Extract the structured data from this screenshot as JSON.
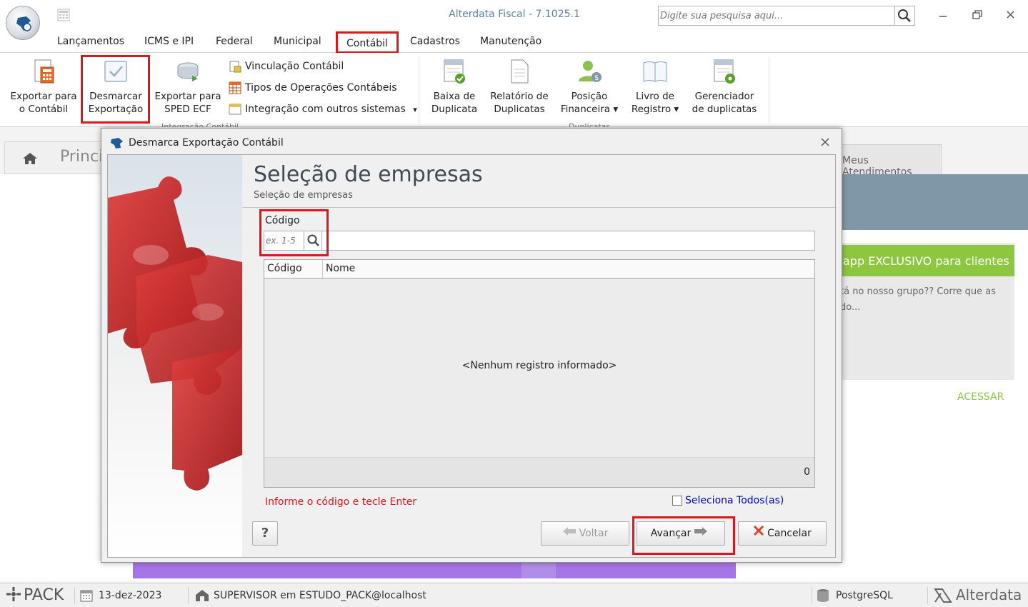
{
  "app": {
    "title": "Alterdata Fiscal - 7.1025.1",
    "search_placeholder": "Digite sua pesquisa aqui...",
    "window_controls": [
      "minimize",
      "restore",
      "close"
    ]
  },
  "menu": {
    "tabs": [
      {
        "label": "Lançamentos"
      },
      {
        "label": "ICMS e IPI"
      },
      {
        "label": "Federal"
      },
      {
        "label": "Municipal"
      },
      {
        "label": "Contábil",
        "active": true
      },
      {
        "label": "Cadastros"
      },
      {
        "label": "Manutenção"
      }
    ]
  },
  "ribbon": {
    "export_contabil": [
      "Exportar para",
      "o Contábil"
    ],
    "desmarcar": [
      "Desmarcar",
      "Exportação"
    ],
    "export_sped": [
      "Exportar para",
      "SPED ECF"
    ],
    "small": [
      {
        "label": "Vinculação Contábil"
      },
      {
        "label": "Tipos de Operações Contábeis"
      },
      {
        "label": "Integração com outros sistemas",
        "caret": "▾"
      }
    ],
    "group_label": "Integração Contábil",
    "baixa": [
      "Baixa de",
      "Duplicata"
    ],
    "relatorio": [
      "Relatório de",
      "Duplicatas"
    ],
    "posicao": [
      "Posição",
      "Financeira ▾"
    ],
    "livro": [
      "Livro de",
      "Registro ▾"
    ],
    "gerenciador": [
      "Gerenciador",
      "de duplicatas"
    ],
    "group_label2": "Duplicatas"
  },
  "background": {
    "home_title": "Princip",
    "right_tab": "Meus Atendimentos",
    "promo_title": "app EXCLUSIVO para clientes",
    "promo_text": "tá no nosso grupo?? Corre que as",
    "promo_text2": "do...",
    "promo_link": "ACESSAR"
  },
  "dialog": {
    "window_title": "Desmarca Exportação Contábil",
    "close": "×",
    "page_title": "Seleção de empresas",
    "page_subtitle": "Seleção de empresas",
    "codigo_label": "Código",
    "codigo_placeholder": "ex. 1-5",
    "grid": {
      "columns": [
        "Código",
        "Nome"
      ],
      "empty_message": "<Nenhum registro informado>",
      "count": "0"
    },
    "hint": "Informe o código e tecle Enter",
    "select_all_label": "Seleciona Todos(as)",
    "select_all_checked": false,
    "buttons": {
      "help": "?",
      "back": "Voltar",
      "next": "Avançar",
      "cancel": "Cancelar"
    }
  },
  "status": {
    "product": "PACK",
    "date": "13-dez-2023",
    "user": "SUPERVISOR em ESTUDO_PACK@localhost",
    "db": "PostgreSQL",
    "brand": "Alterdata"
  },
  "colors": {
    "highlight": "#e0141b",
    "title_blue": "#5b7fa8",
    "promo_green": "#8dc63f",
    "link_blue": "#0000cc"
  }
}
